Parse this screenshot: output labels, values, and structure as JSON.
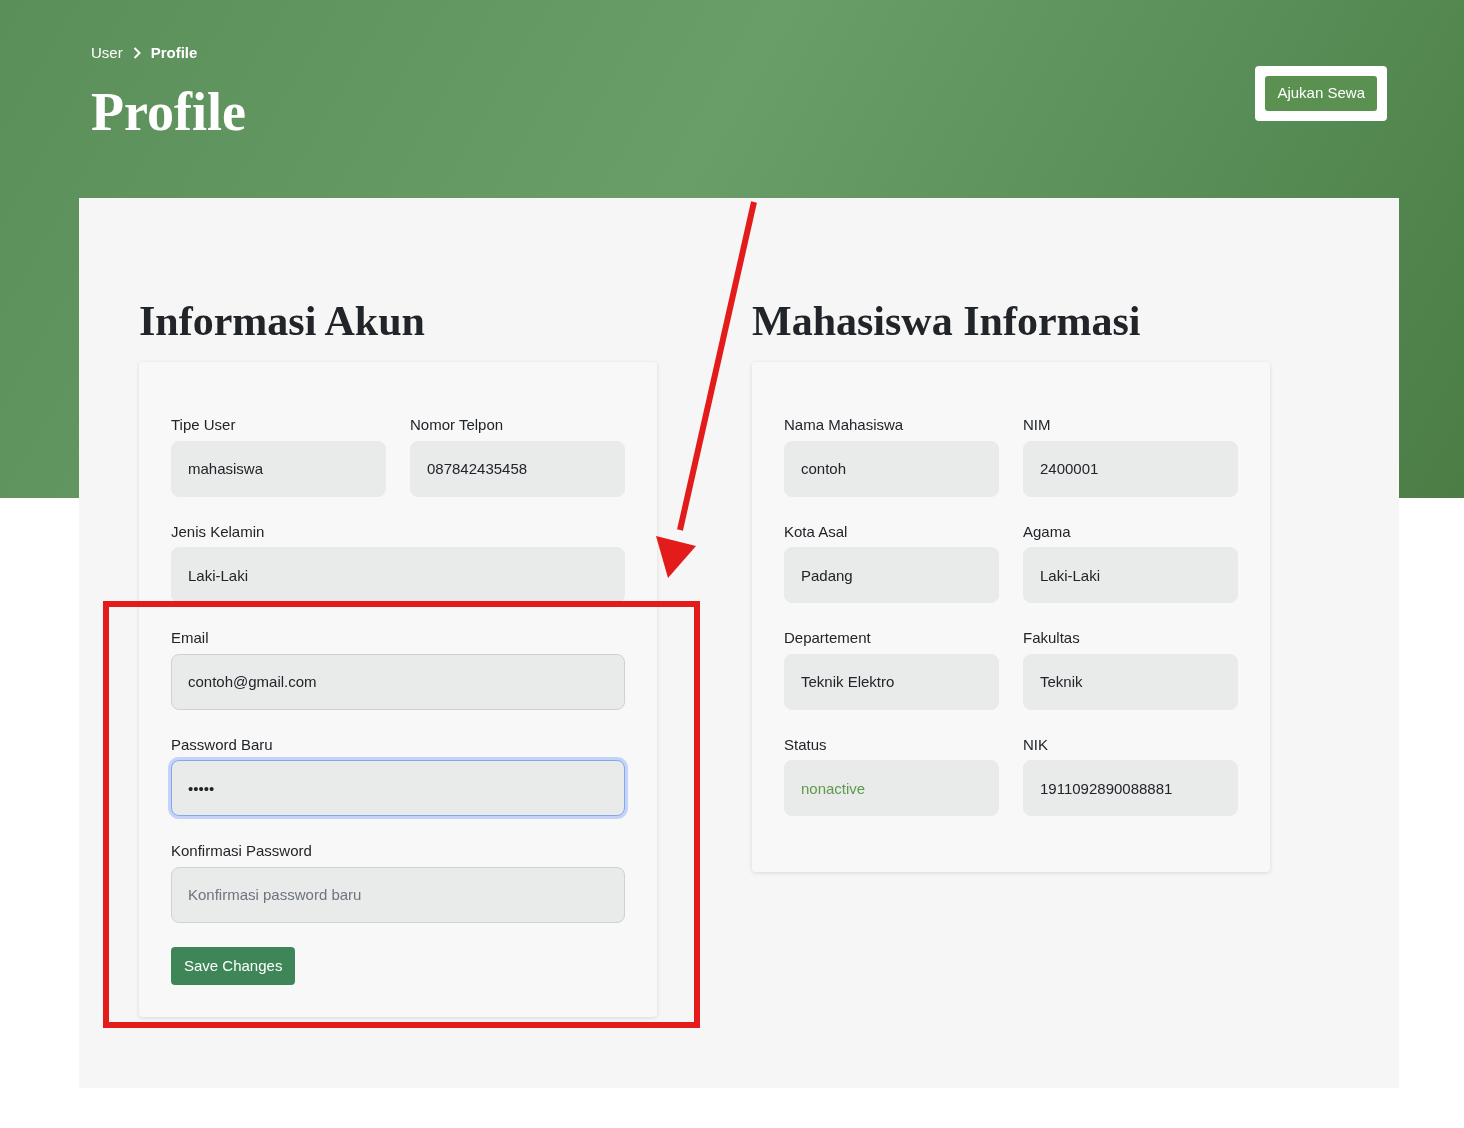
{
  "breadcrumb": [
    {
      "label": "User",
      "selected": false
    },
    {
      "label": "Profile",
      "selected": true
    }
  ],
  "page_title": "Profile",
  "action_button": "Ajukan Sewa",
  "sections": [
    {
      "title": "Informasi Akun",
      "rows": [
        [
          {
            "label": "Tipe User",
            "value": "mahasiswa",
            "kind": "plain"
          },
          {
            "label": "Nomor Telpon",
            "value": "087842435458",
            "kind": "plain"
          }
        ],
        [
          {
            "label": "Jenis Kelamin",
            "value": "Laki-Laki",
            "kind": "plain"
          }
        ],
        [
          {
            "label": "Email",
            "value": "contoh@gmail.com",
            "kind": "input",
            "focused": false
          }
        ],
        [
          {
            "label": "Password Baru",
            "value": "•••••",
            "kind": "input",
            "focused": true
          }
        ],
        [
          {
            "label": "Konfirmasi Password",
            "placeholder": "Konfirmasi password baru",
            "kind": "input",
            "focused": false
          }
        ]
      ],
      "submit": "Save Changes"
    },
    {
      "title": "Mahasiswa Informasi",
      "rows": [
        [
          {
            "label": "Nama Mahasiswa",
            "value": "contoh",
            "kind": "plain"
          },
          {
            "label": "NIM",
            "value": "2400001",
            "kind": "plain"
          }
        ],
        [
          {
            "label": "Kota Asal",
            "value": "Padang",
            "kind": "plain"
          },
          {
            "label": "Agama",
            "value": "Laki-Laki",
            "kind": "plain"
          }
        ],
        [
          {
            "label": "Departement",
            "value": "Teknik Elektro",
            "kind": "plain"
          },
          {
            "label": "Fakultas",
            "value": "Teknik",
            "kind": "plain"
          }
        ],
        [
          {
            "label": "Status",
            "value": "nonactive",
            "kind": "plain",
            "color": "#5f9a4c"
          },
          {
            "label": "NIK",
            "value": "1911092890088881",
            "kind": "plain"
          }
        ]
      ]
    }
  ]
}
